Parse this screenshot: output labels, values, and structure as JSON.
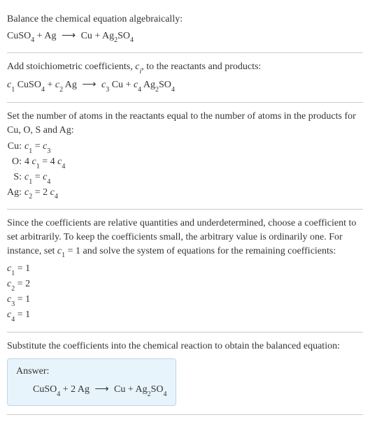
{
  "section1": {
    "intro": "Balance the chemical equation algebraically:",
    "eq_lhs1": "CuSO",
    "eq_lhs1_sub": "4",
    "eq_plus": " + ",
    "eq_lhs2": "Ag",
    "eq_arrow": "⟶",
    "eq_rhs1": "Cu + Ag",
    "eq_rhs1_sub": "2",
    "eq_rhs2": "SO",
    "eq_rhs2_sub": "4"
  },
  "section2": {
    "intro_a": "Add stoichiometric coefficients, ",
    "intro_ci": "c",
    "intro_ci_sub": "i",
    "intro_b": ", to the reactants and products:",
    "c1": "c",
    "s1": "1",
    "t1": " CuSO",
    "u1": "4",
    "plus1": " + ",
    "c2": "c",
    "s2": "2",
    "t2": " Ag",
    "arrow": "⟶",
    "c3": "c",
    "s3": "3",
    "t3": " Cu + ",
    "c4": "c",
    "s4": "4",
    "t4": " Ag",
    "u4": "2",
    "t5": "SO",
    "u5": "4"
  },
  "section3": {
    "intro": "Set the number of atoms in the reactants equal to the number of atoms in the products for Cu, O, S and Ag:",
    "rows": [
      {
        "el": "Cu:",
        "lhs_c": "c",
        "lhs_s": "1",
        "mid": " = ",
        "rhs_c": "c",
        "rhs_s": "3",
        "pre": "",
        "rpre": ""
      },
      {
        "el": "O:",
        "lhs_c": "c",
        "lhs_s": "1",
        "mid": " = 4 ",
        "rhs_c": "c",
        "rhs_s": "4",
        "pre": "4 ",
        "rpre": ""
      },
      {
        "el": "S:",
        "lhs_c": "c",
        "lhs_s": "1",
        "mid": " = ",
        "rhs_c": "c",
        "rhs_s": "4",
        "pre": "",
        "rpre": ""
      },
      {
        "el": "Ag:",
        "lhs_c": "c",
        "lhs_s": "2",
        "mid": " = 2 ",
        "rhs_c": "c",
        "rhs_s": "4",
        "pre": "",
        "rpre": ""
      }
    ]
  },
  "section4": {
    "intro_a": "Since the coefficients are relative quantities and underdetermined, choose a coefficient to set arbitrarily. To keep the coefficients small, the arbitrary value is ordinarily one. For instance, set ",
    "intro_c": "c",
    "intro_s": "1",
    "intro_b": " = 1 and solve the system of equations for the remaining coefficients:",
    "lines": [
      {
        "c": "c",
        "s": "1",
        "v": " = 1"
      },
      {
        "c": "c",
        "s": "2",
        "v": " = 2"
      },
      {
        "c": "c",
        "s": "3",
        "v": " = 1"
      },
      {
        "c": "c",
        "s": "4",
        "v": " = 1"
      }
    ]
  },
  "section5": {
    "intro": "Substitute the coefficients into the chemical reaction to obtain the balanced equation:",
    "answer_label": "Answer:",
    "eq_a": "CuSO",
    "eq_a_sub": "4",
    "eq_b": " + 2 Ag",
    "eq_arrow": "⟶",
    "eq_c": "Cu + Ag",
    "eq_c_sub": "2",
    "eq_d": "SO",
    "eq_d_sub": "4"
  }
}
